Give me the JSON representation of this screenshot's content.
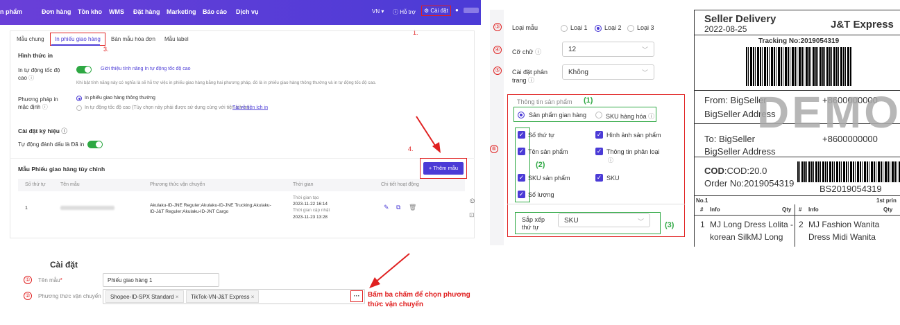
{
  "topnav": {
    "items": [
      "n phẩm",
      "Đơn hàng",
      "Tồn kho",
      "WMS",
      "Đặt hàng",
      "Marketing",
      "Báo cáo",
      "Dịch vụ"
    ],
    "lang": "VN",
    "help": "Hỗ trợ",
    "settings": "Cài đặt"
  },
  "tabs": [
    "Mẫu chung",
    "In phiếu giao hàng",
    "Bản mẫu hóa đơn",
    "Mẫu label"
  ],
  "steps": {
    "s1": "1.",
    "s3": "3.",
    "s4": "4."
  },
  "print_form": {
    "heading": "Hình thức in",
    "auto_label": "In tự động tốc độ cao",
    "auto_link": "Giới thiệu tính năng In tự động tốc độ cao",
    "auto_desc": "Khi bật tính năng này có nghĩa là sẽ hỗ trợ việc in phiếu giao hàng bằng hai phương pháp, đó là in phiếu giao hàng thông thường và in tự động tốc độ cao.",
    "method_label": "Phương pháp in mặc định",
    "method_opt1": "In phiếu giao hàng thông thường",
    "method_opt2": "In tự động tốc độ cao (Tùy chọn này phải được sử dụng cùng với tiện ích in)",
    "method_link": "Tải về tiện ích in"
  },
  "symbol": {
    "heading": "Cài đặt ký hiệu",
    "auto_mark": "Tự động đánh dấu là Đã in"
  },
  "custom": {
    "heading": "Mẫu Phiếu giao hàng tùy chỉnh",
    "add_button": "+ Thêm mẫu",
    "columns": [
      "Số thứ tự",
      "Tên mẫu",
      "Phương thức vận chuyển",
      "Thời gian",
      "Chi tiết hoạt động"
    ],
    "row": {
      "index": "1",
      "shipping_line1": "Akulaku-ID-JNE Reguler;Akulaku-ID-JNE Trucking;Akulaku-",
      "shipping_line2": "ID-J&T Reguler;Akulaku-ID-JNT Cargo",
      "created_label": "Thời gian tạo",
      "created": "2023-11-22 16:14",
      "updated_label": "Thời gian cập nhật",
      "updated": "2023-11-23 13:28"
    }
  },
  "settings_form": {
    "circle_labels": [
      "③",
      "④",
      "⑤",
      "⑥"
    ],
    "type_label": "Loại mẫu",
    "types": [
      "Loại 1",
      "Loại 2",
      "Loại 3"
    ],
    "font_label": "Cỡ chữ",
    "font_value": "12",
    "paging_label": "Cài đặt phân trang",
    "paging_value": "Không",
    "product_heading": "Thông tin sản phẩm",
    "g1": "(1)",
    "g2": "(2)",
    "g3": "(3)",
    "source_opt1": "Sản phẩm gian hàng",
    "source_opt2": "SKU hàng hóa",
    "checks": [
      "Số thứ tự",
      "Hình ảnh sản phẩm",
      "Tên sản phẩm",
      "Thông tin phân loại",
      "SKU sản phẩm",
      "SKU",
      "Số lượng"
    ],
    "sort_label": "Sắp xếp thứ tự",
    "sort_value": "SKU"
  },
  "label": {
    "title": "Seller Delivery",
    "date": "2022-08-25",
    "carrier": "J&T Express",
    "tracking": "Tracking No:2019054319",
    "from_line1": "From: BigSeller",
    "from_phone": "+8600000000",
    "from_line2": "BigSeller Address",
    "watermark": "DEMO",
    "to_line1": "To:  BigSeller",
    "to_phone": "+8600000000",
    "to_line2": "BigSeller Address",
    "cod": "COD:20.0",
    "order": "Order No:2019054319",
    "bs_code": "BS2019054319",
    "no": "No.1",
    "first_print": "1st prin",
    "cols": [
      "#",
      "Info",
      "Qty",
      "#",
      "Info",
      "Qty"
    ],
    "item1_no": "1",
    "item1": [
      "MJ Long Dress Lolita -",
      "korean SilkMJ Long"
    ],
    "item2_no": "2",
    "item2": [
      "MJ Fashion Wanita",
      "Dress Midi Wanita"
    ]
  },
  "bottom": {
    "title": "Cài đặt",
    "name_label": "Tên mẫu",
    "name_value": "Phiếu giao hàng 1",
    "ship_label": "Phương thức vận chuyển",
    "tags": [
      "Shopee-ID-SPX Standard",
      "TikTok-VN-J&T Express"
    ],
    "more": "···",
    "circle1": "①",
    "circle2": "②",
    "hint_line1": "Bấm ba chấm để chọn phương",
    "hint_line2": "thức vận chuyển"
  }
}
